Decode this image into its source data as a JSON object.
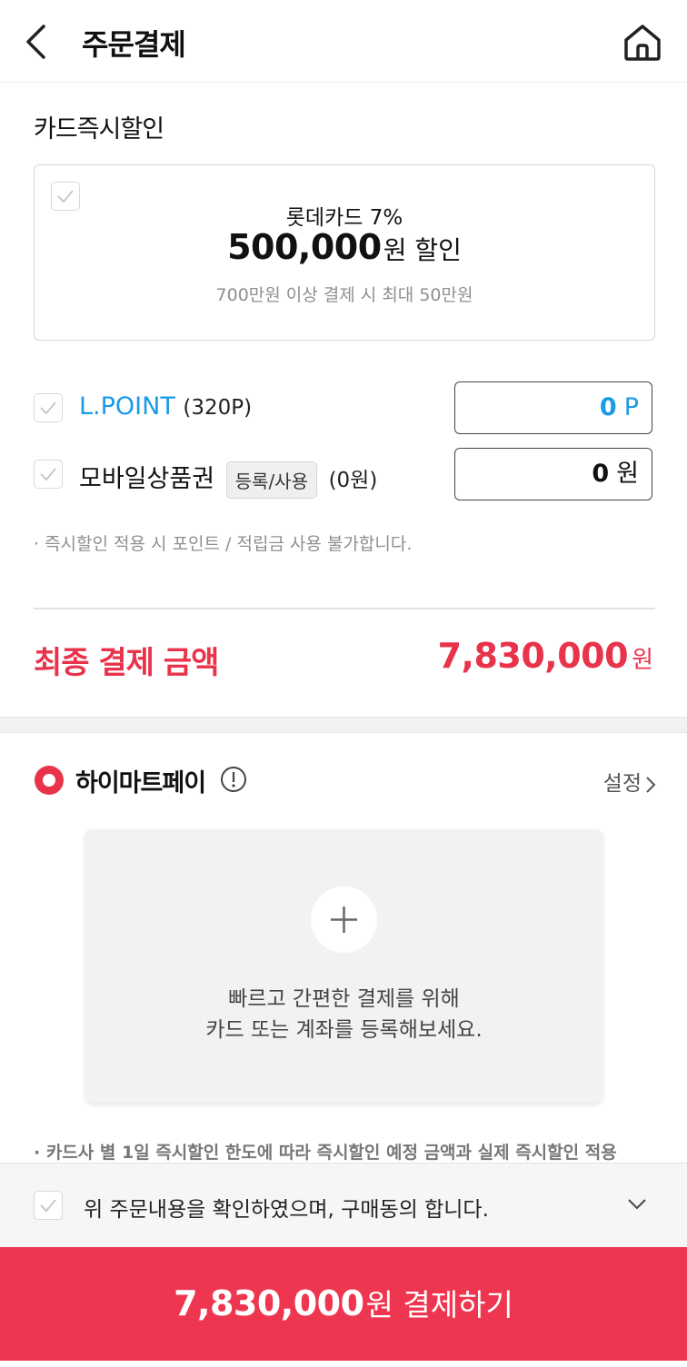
{
  "header": {
    "title": "주문결제"
  },
  "card_discount": {
    "section_label": "카드즉시할인",
    "card_name": "롯데카드 7%",
    "amount": "500,000",
    "amount_suffix": "원 할인",
    "note": "700만원 이상 결제 시 최대 50만원"
  },
  "lpoint": {
    "label": "L.POINT",
    "balance": "(320P)",
    "value": "0",
    "unit": "P"
  },
  "mobile_gift": {
    "label": "모바일상품권",
    "button": "등록/사용",
    "balance": "(0원)",
    "value": "0",
    "unit": "원"
  },
  "notice": "· 즉시할인 적용 시 포인트 / 적립금 사용 불가합니다.",
  "final": {
    "label": "최종 결제 금액",
    "amount": "7,830,000",
    "unit": "원"
  },
  "hipay": {
    "title": "하이마트페이",
    "settings": "설정",
    "add_line1": "빠르고 간편한 결제를 위해",
    "add_line2": "카드 또는 계좌를 등록해보세요."
  },
  "warning": "· 카드사 별 1일 즉시할인 한도에 따라 즉시할인 예정 금액과 실제 즉시할인 적용",
  "agree": {
    "text": "위 주문내용을 확인하였으며, 구매동의 합니다."
  },
  "pay_button": {
    "amount": "7,830,000",
    "label": "원 결제하기"
  },
  "colors": {
    "accent": "#e8334b",
    "button": "#ef3650",
    "lpoint_blue": "#1a9be6"
  }
}
